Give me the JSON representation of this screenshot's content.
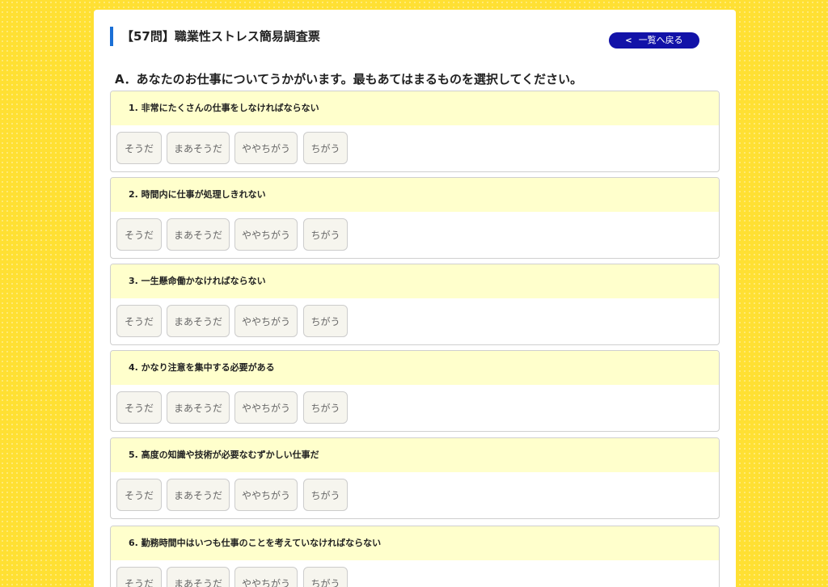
{
  "page": {
    "title": "【57問】職業性ストレス簡易調査票",
    "back_label": "一覧へ戻る",
    "back_icon": "chevron-left-icon",
    "section_heading": "A．あなたのお仕事についてうかがいます。最もあてはまるものを選択してください。"
  },
  "colors": {
    "background": "#ffe033",
    "accent": "#1a6fd6",
    "back_button": "#1212a8",
    "question_header": "#ffffcc"
  },
  "options": [
    "そうだ",
    "まあそうだ",
    "ややちがう",
    "ちがう"
  ],
  "questions": [
    {
      "label": "1. 非常にたくさんの仕事をしなければならない"
    },
    {
      "label": "2. 時間内に仕事が処理しきれない"
    },
    {
      "label": "3. 一生懸命働かなければならない"
    },
    {
      "label": "4. かなり注意を集中する必要がある"
    },
    {
      "label": "5. 高度の知識や技術が必要なむずかしい仕事だ"
    },
    {
      "label": "6. 勤務時間中はいつも仕事のことを考えていなければならない"
    }
  ]
}
